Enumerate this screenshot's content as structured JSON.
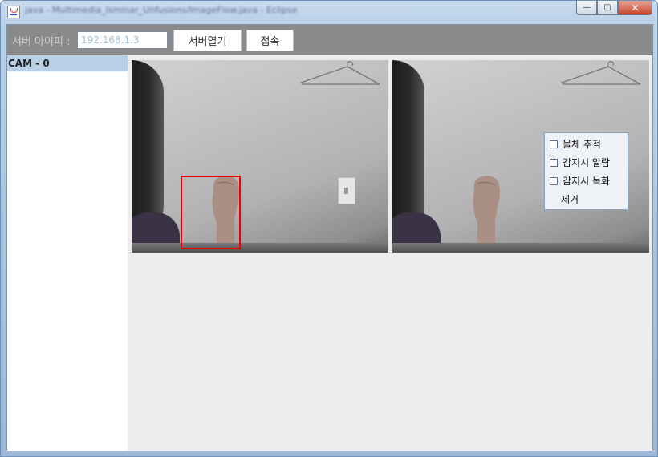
{
  "window": {
    "title": "java - Multimedia_Isminar_Unfusions/ImageFlow.java - Eclipse",
    "controls": {
      "minimize": "—",
      "maximize": "▢",
      "close": "✕"
    }
  },
  "toolbar": {
    "server_ip_label": "서버 아이피 :",
    "server_ip_value": "192.168.1.3",
    "open_server_label": "서버열기",
    "connect_label": "접속"
  },
  "sidebar": {
    "items": [
      {
        "label": "CAM - 0",
        "selected": true
      }
    ]
  },
  "feeds": [
    {
      "name": "left-camera-feed",
      "tracking_box": true
    },
    {
      "name": "right-camera-feed",
      "tracking_box": false
    }
  ],
  "context_menu": {
    "items": [
      {
        "label": "물체 추적",
        "checked": false
      },
      {
        "label": "감지시 알람",
        "checked": false
      },
      {
        "label": "감지시 녹화",
        "checked": false
      },
      {
        "label": "제거"
      }
    ]
  },
  "colors": {
    "tracking_box": "#e00000",
    "selected_item": "#b8cfe6",
    "toolbar_bg": "#8a8a8a"
  }
}
